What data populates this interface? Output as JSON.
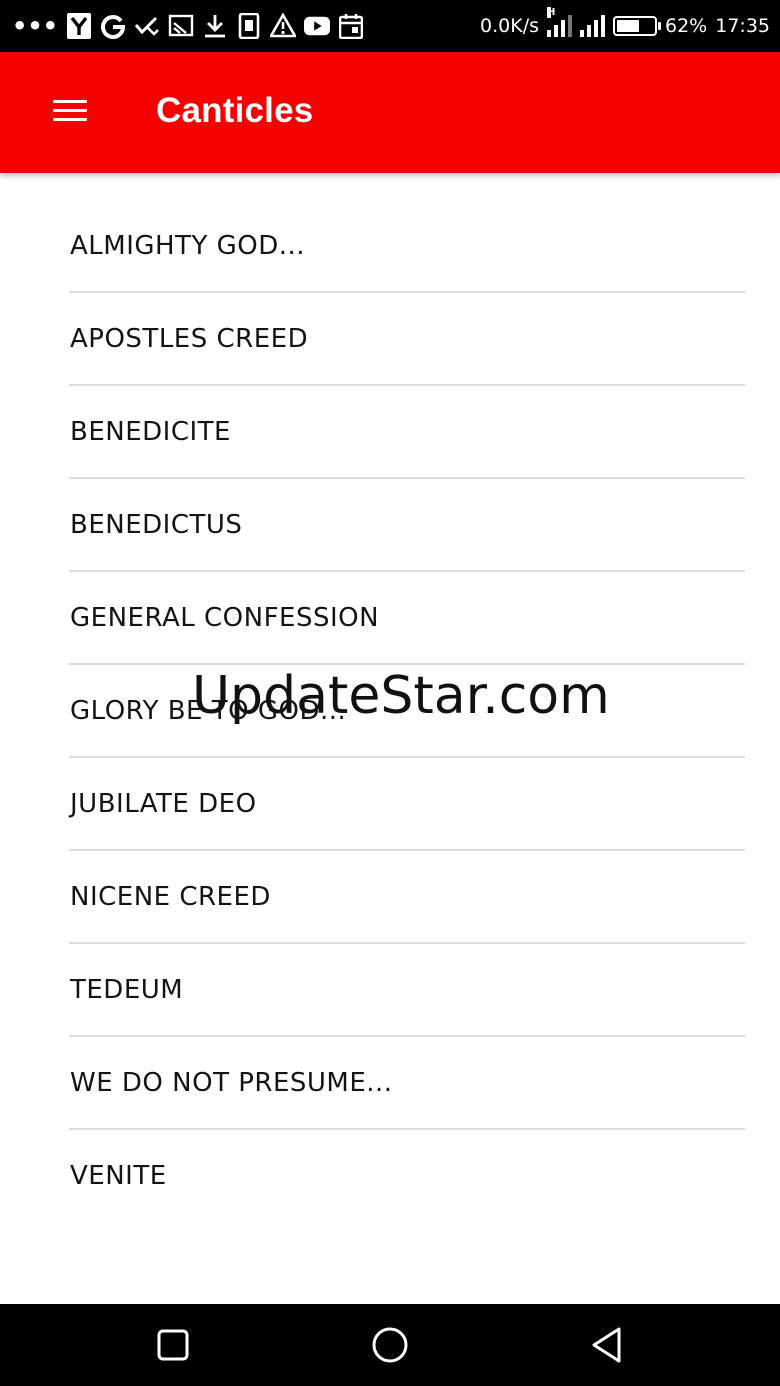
{
  "status_bar": {
    "notification_icons": [
      "more-dots-icon",
      "yahoo-icon",
      "google-icon",
      "check-download-icon",
      "cast-icon",
      "download-icon",
      "sim-card-icon",
      "warning-icon",
      "youtube-icon",
      "calendar-icon"
    ],
    "network_speed": "0.0K/s",
    "network_type": "H",
    "battery_percent": "62%",
    "battery_level": 0.62,
    "time": "17:35"
  },
  "app_bar": {
    "title": "Canticles",
    "color": "#f70100",
    "menu_icon": "hamburger-menu-icon"
  },
  "canticles": [
    "ALMIGHTY GOD...",
    "APOSTLES CREED",
    "BENEDICITE",
    "BENEDICTUS",
    "GENERAL CONFESSION",
    "GLORY BE TO GOD...",
    "JUBILATE DEO",
    "NICENE CREED",
    "TEDEUM",
    "WE DO NOT PRESUME...",
    "VENITE"
  ],
  "watermark": "UpdateStar.com",
  "nav_bar": {
    "icons": [
      "recent-apps-icon",
      "home-icon",
      "back-icon"
    ]
  }
}
